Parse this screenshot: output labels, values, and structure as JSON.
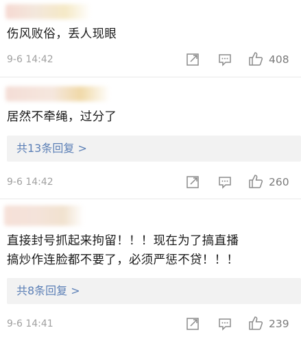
{
  "comments": [
    {
      "text": [
        "伤风败俗，丢人现眼"
      ],
      "reply_label": "",
      "timestamp": "9-6 14:42",
      "likes": "408"
    },
    {
      "text": [
        "居然不牵绳，过分了"
      ],
      "reply_label": "共13条回复 >",
      "timestamp": "9-6 14:42",
      "likes": "260"
    },
    {
      "text": [
        "直接封号抓起来拘留！！！现在为了搞直播",
        "搞炒作连脸都不要了，必须严惩不贷！！！"
      ],
      "reply_label": "共8条回复 >",
      "timestamp": "9-6 14:41",
      "likes": "239"
    }
  ],
  "colors": {
    "text": "#1a1a1a",
    "meta": "#a0a0a0",
    "link": "#5b7fb6",
    "reply_bg": "#f2f2f2",
    "icon": "#8a8a8a"
  },
  "icons": [
    "share-icon",
    "comment-icon",
    "like-icon"
  ]
}
